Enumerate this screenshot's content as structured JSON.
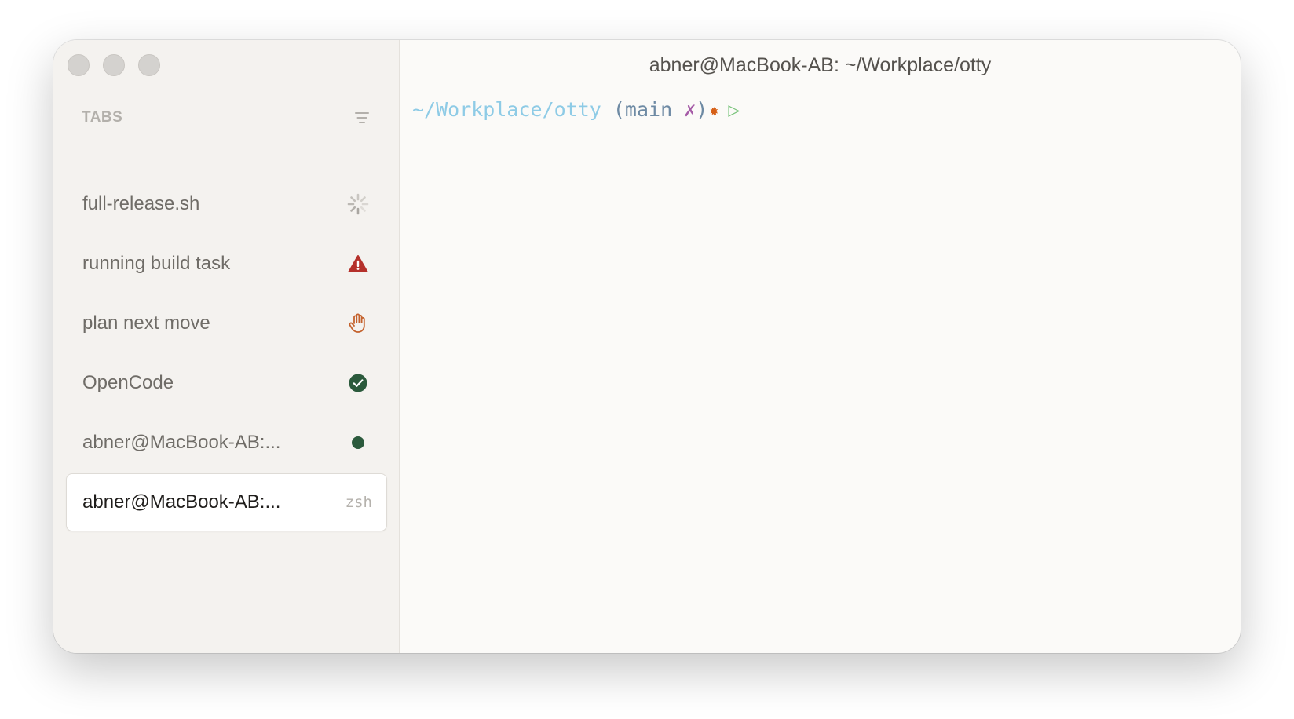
{
  "window": {
    "title": "abner@MacBook-AB: ~/Workplace/otty"
  },
  "sidebar": {
    "header": "TABS",
    "tabs": [
      {
        "label": "full-release.sh",
        "status": "loading-spinner-icon"
      },
      {
        "label": "running build task",
        "status": "warning-icon",
        "color": "#b5312b"
      },
      {
        "label": "plan next move",
        "status": "hand-icon",
        "color": "#c4622d"
      },
      {
        "label": "OpenCode",
        "status": "check-circle-icon",
        "color": "#2b5a3c"
      },
      {
        "label": "abner@MacBook-AB:...",
        "status": "dot-icon",
        "color": "#2b5a3c"
      },
      {
        "label": "abner@MacBook-AB:...",
        "shell": "zsh",
        "active": true
      }
    ]
  },
  "terminal": {
    "path": "~/Workplace/otty",
    "branch_open": " (main ",
    "dirty_mark": "✗",
    "branch_close": ")",
    "star": "✹",
    "prompt_symbol": "▷",
    "colors": {
      "path": "#8ecbe6",
      "branch": "#6e8aa4",
      "dirty": "#a55ba7",
      "star": "#d65f16",
      "prompt": "#7bc47d"
    }
  }
}
